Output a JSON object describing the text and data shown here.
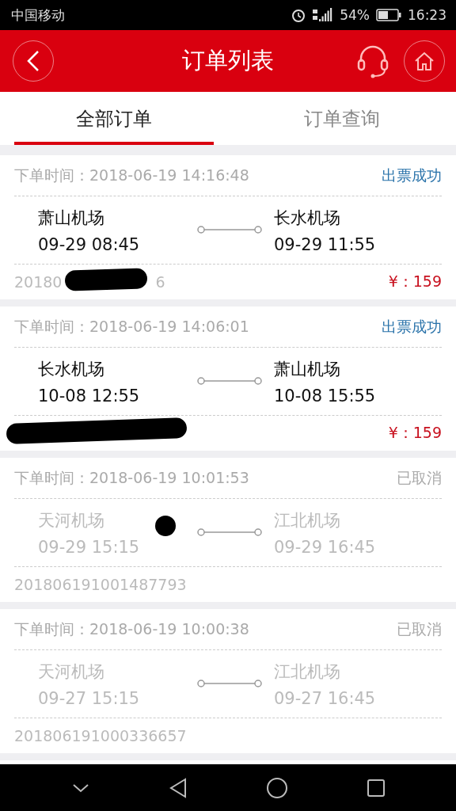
{
  "status_bar": {
    "carrier": "中国移动",
    "battery_text": "54%",
    "time": "16:23"
  },
  "header": {
    "title": "订单列表"
  },
  "tabs": [
    {
      "label": "全部订单",
      "selected": true
    },
    {
      "label": "订单查询",
      "selected": false
    }
  ],
  "orders": [
    {
      "order_time_label": "下单时间：",
      "order_time": "2018-06-19 14:16:48",
      "status": "出票成功",
      "kind": "issued",
      "from": "萧山机场",
      "from_time": "09-29 08:45",
      "to": "长水机场",
      "to_time": "09-29 11:55",
      "order_number_parts": [
        "20180",
        "6"
      ],
      "redacted": true,
      "price": "¥：159",
      "marked": false
    },
    {
      "order_time_label": "下单时间：",
      "order_time": "2018-06-19 14:06:01",
      "status": "出票成功",
      "kind": "issued",
      "from": "长水机场",
      "from_time": "10-08 12:55",
      "to": "萧山机场",
      "to_time": "10-08 15:55",
      "redacted": true,
      "price": "¥：159",
      "marked": false
    },
    {
      "order_time_label": "下单时间：",
      "order_time": "2018-06-19 10:01:53",
      "status": "已取消",
      "kind": "cancelled",
      "from": "天河机场",
      "from_time": "09-29 15:15",
      "to": "江北机场",
      "to_time": "09-29 16:45",
      "order_number_parts": [
        "201806191001487793"
      ],
      "redacted": false,
      "marked": true
    },
    {
      "order_time_label": "下单时间：",
      "order_time": "2018-06-19 10:00:38",
      "status": "已取消",
      "kind": "cancelled",
      "from": "天河机场",
      "from_time": "09-27 15:15",
      "to": "江北机场",
      "to_time": "09-27 16:45",
      "order_number_parts": [
        "201806191000336657"
      ],
      "redacted": false,
      "marked": false
    }
  ]
}
